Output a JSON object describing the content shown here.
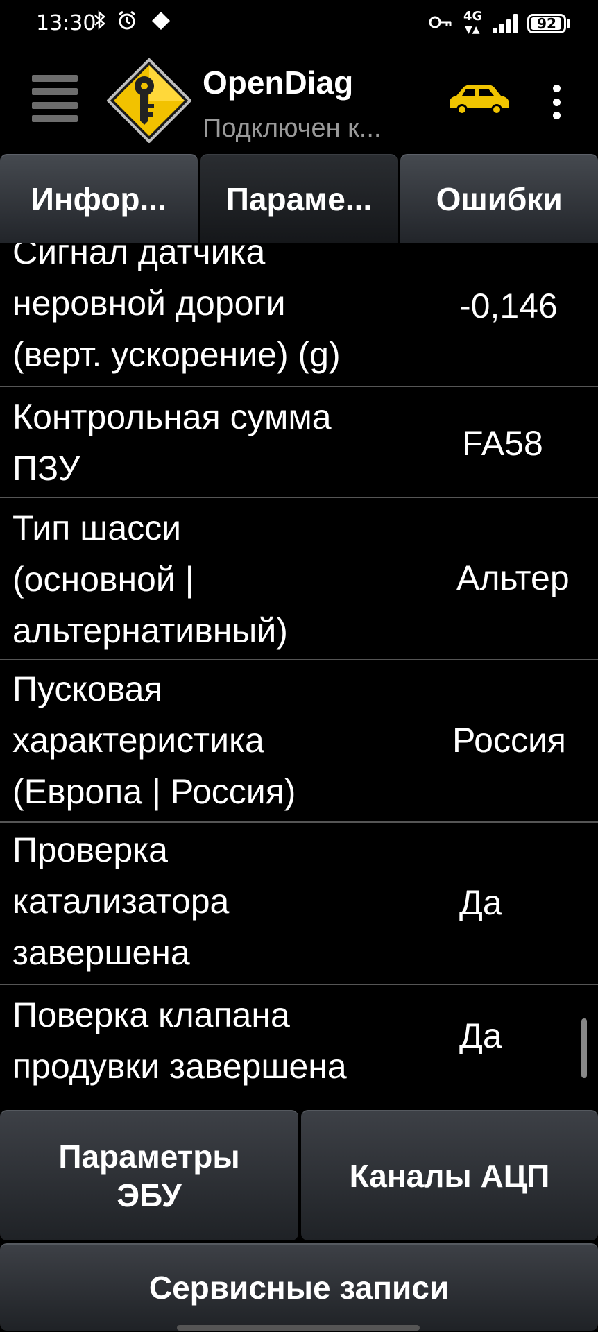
{
  "status_bar": {
    "time": "13:30",
    "network": "4G",
    "battery": "92",
    "icons": [
      "bluetooth-icon",
      "alarm-icon",
      "diamond-icon",
      "key-icon",
      "network-4g-icon",
      "signal-icon",
      "battery-icon"
    ]
  },
  "app_bar": {
    "title": "OpenDiag",
    "subtitle": "Подключен к...",
    "icons": [
      "menu-icon",
      "app-logo-key-icon",
      "car-icon",
      "more-vert-icon"
    ],
    "car_color": "#f0c400"
  },
  "tabs": [
    {
      "label": "Инфор..."
    },
    {
      "label": "Параме..."
    },
    {
      "label": "Ошибки"
    }
  ],
  "params": [
    {
      "name_lines": [
        "Сигнал датчика",
        "неровной дороги",
        "(верт. ускорение) (g)"
      ],
      "value": "-0,146"
    },
    {
      "name_lines": [
        "Контрольная сумма",
        "ПЗУ"
      ],
      "value": "FA58"
    },
    {
      "name_lines": [
        "Тип шасси",
        "(основной |",
        "альтернативный)"
      ],
      "value": "Альтер"
    },
    {
      "name_lines": [
        "Пусковая",
        "характеристика",
        "(Европа | Россия)"
      ],
      "value": "Россия"
    },
    {
      "name_lines": [
        "Проверка",
        "катализатора",
        "завершена"
      ],
      "value": "Да"
    },
    {
      "name_lines": [
        "Поверка клапана",
        "продувки завершена"
      ],
      "value": "Да"
    }
  ],
  "bottom_buttons": {
    "ecu_params_line1": "Параметры",
    "ecu_params_line2": "ЭБУ",
    "adc_channels": "Каналы АЦП",
    "service_records": "Сервисные записи"
  },
  "colors": {
    "background": "#000000",
    "button_top": "#3d4046",
    "button_bottom": "#1f2226",
    "divider": "#555555",
    "subtitle": "#9a9a9a"
  }
}
